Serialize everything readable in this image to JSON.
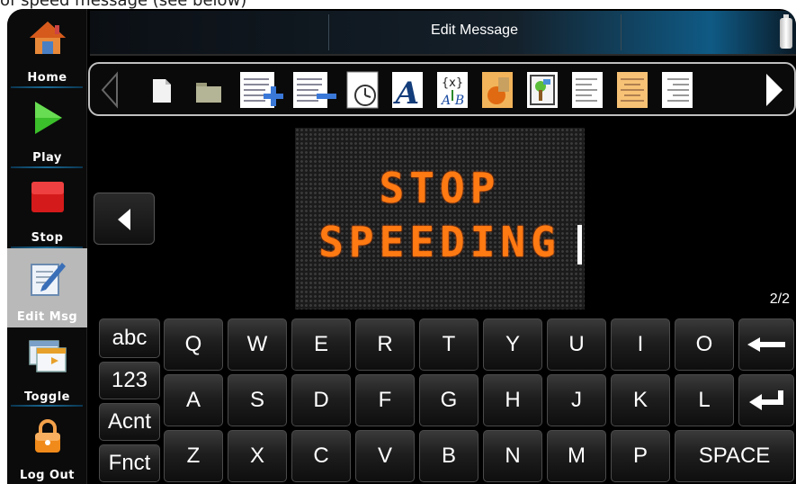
{
  "caption": "of speed message (see below)",
  "sidebar": {
    "items": [
      {
        "label": "Home",
        "icon": "home-icon"
      },
      {
        "label": "Play",
        "icon": "play-icon"
      },
      {
        "label": "Stop",
        "icon": "stop-icon"
      },
      {
        "label": "Edit Msg",
        "icon": "edit-icon"
      },
      {
        "label": "Toggle",
        "icon": "toggle-window-icon"
      },
      {
        "label": "Log Out",
        "icon": "lock-icon"
      }
    ]
  },
  "header": {
    "title": "Edit Message"
  },
  "toolbar": {
    "items": [
      "scroll-left-icon",
      "new-page-icon",
      "folder-icon",
      "add-line-icon",
      "remove-line-icon",
      "page-timing-icon",
      "font-icon",
      "variable-icon",
      "graphic-icon",
      "image-icon",
      "align-left-icon",
      "align-center-icon",
      "align-right-icon",
      "scroll-right-icon"
    ]
  },
  "sign": {
    "line1": "STOP",
    "line2": "SPEEDING",
    "text_color": "#ff7a12"
  },
  "page_indicator": "2/2",
  "keyboard": {
    "modes": [
      "abc",
      "123",
      "Acnt",
      "Fnct"
    ],
    "row1": [
      "Q",
      "W",
      "E",
      "R",
      "T",
      "Y",
      "U",
      "I",
      "O"
    ],
    "row2": [
      "A",
      "S",
      "D",
      "F",
      "G",
      "H",
      "J",
      "K",
      "L"
    ],
    "row3": [
      "Z",
      "X",
      "C",
      "V",
      "B",
      "N",
      "M",
      "P"
    ],
    "space_label": "SPACE"
  }
}
